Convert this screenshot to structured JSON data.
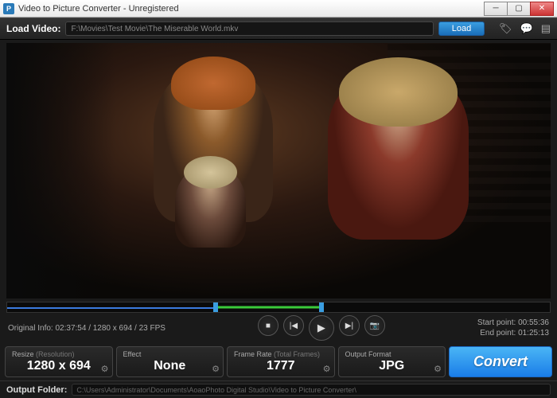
{
  "window": {
    "title": "Video to Picture Converter - Unregistered",
    "icon_letter": "P"
  },
  "loadbar": {
    "label": "Load Video:",
    "path": "F:\\Movies\\Test Movie\\The Miserable World.mkv",
    "load_btn": "Load"
  },
  "timeline": {
    "original_label": "Original Info:",
    "original_info": "02:37:54 / 1280 x 694 / 23 FPS",
    "start_label": "Start point:",
    "start_val": "00:55:36",
    "end_label": "End point:",
    "end_val": "01:25:13"
  },
  "params": {
    "resize": {
      "title": "Resize",
      "sub": "(Resolution)",
      "val": "1280 x 694"
    },
    "effect": {
      "title": "Effect",
      "sub": "",
      "val": "None"
    },
    "framerate": {
      "title": "Frame Rate",
      "sub": "(Total Frames)",
      "val": "1777"
    },
    "format": {
      "title": "Output Format",
      "sub": "",
      "val": "JPG"
    }
  },
  "convert_btn": "Convert",
  "output": {
    "label": "Output Folder:",
    "path": "C:\\Users\\Administrator\\Documents\\AoaoPhoto Digital Studio\\Video to Picture Converter\\"
  }
}
